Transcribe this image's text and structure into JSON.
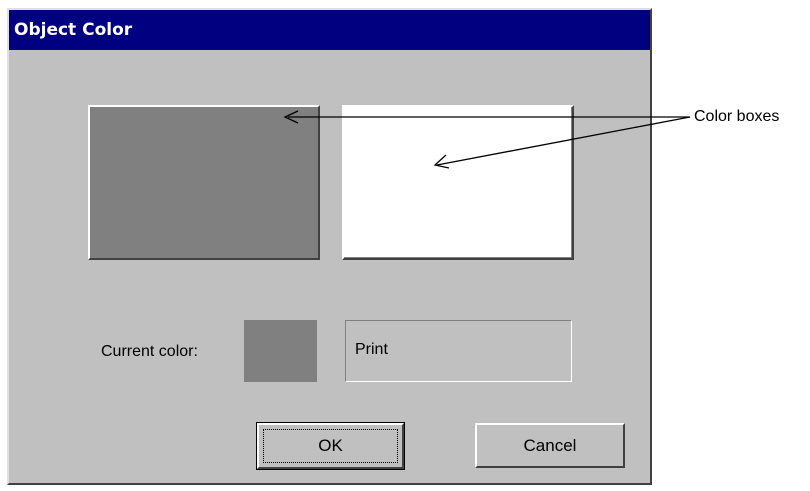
{
  "dialog": {
    "title": "Object Color"
  },
  "color_boxes": [
    {
      "color": "#808080"
    },
    {
      "color": "#ffffff"
    }
  ],
  "current": {
    "label": "Current color:",
    "swatch_color": "#808080",
    "name": "Print"
  },
  "buttons": {
    "ok": "OK",
    "cancel": "Cancel"
  },
  "annotation": {
    "label": "Color boxes"
  }
}
